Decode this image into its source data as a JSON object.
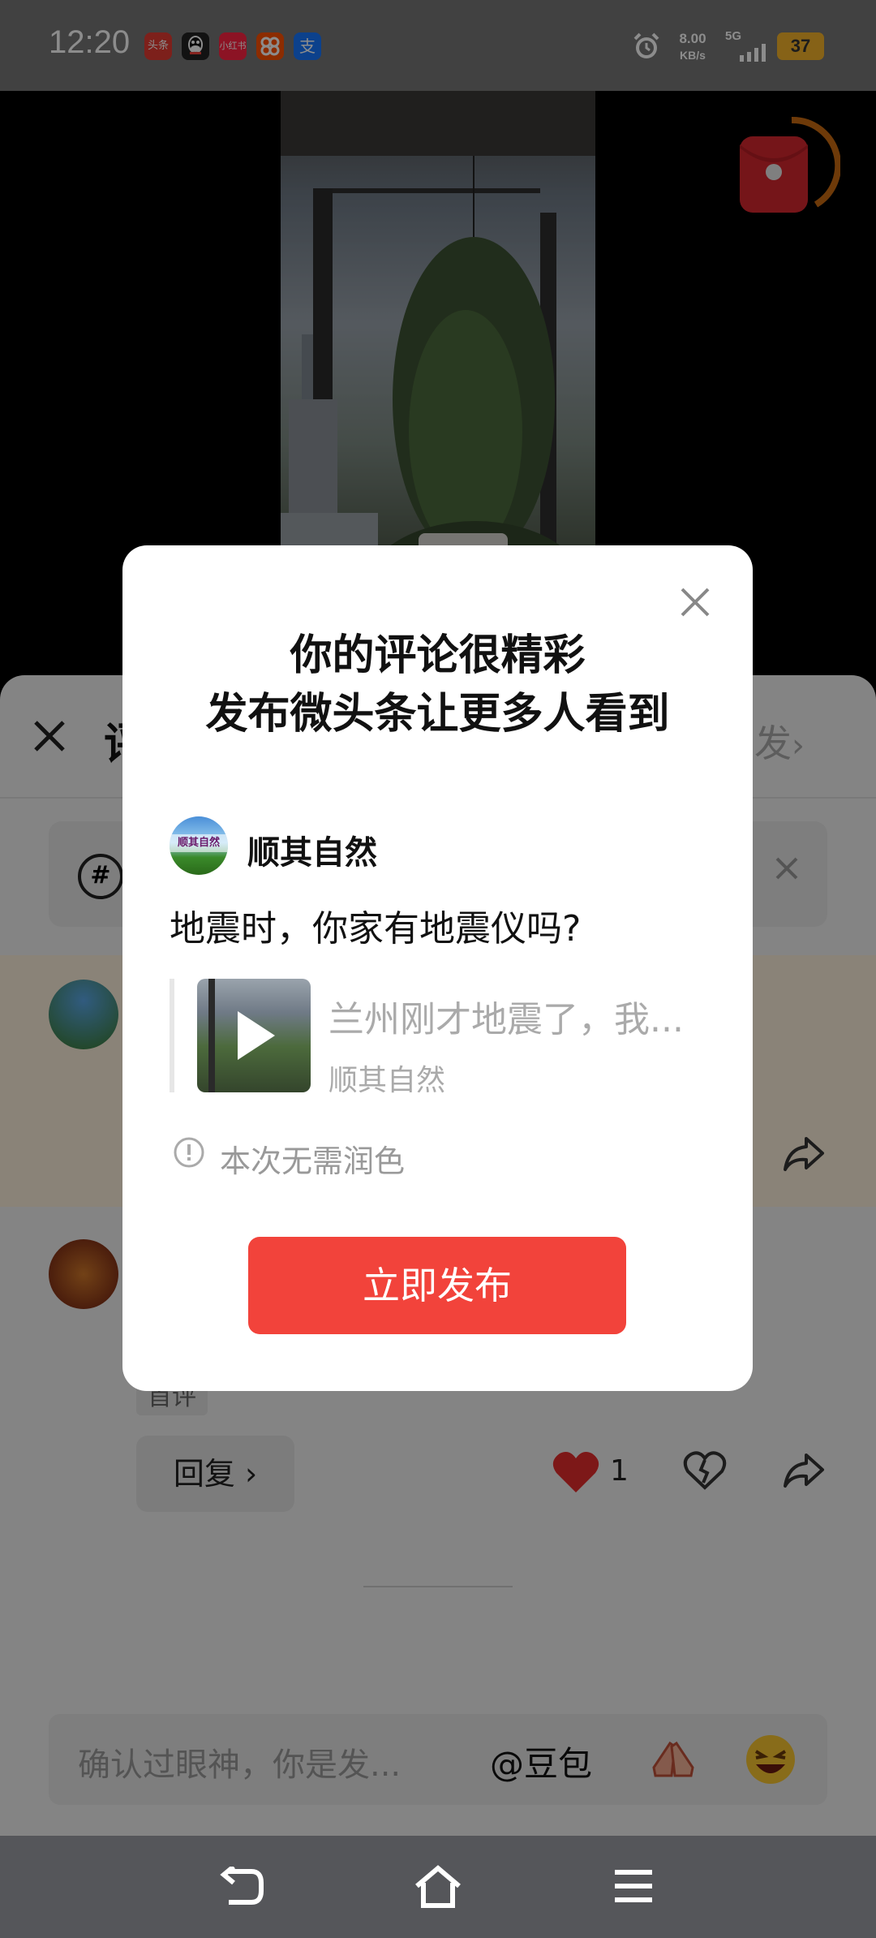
{
  "status_bar": {
    "time": "12:20",
    "apps": [
      {
        "icon": "toutiao-app-icon",
        "label": "头条",
        "color": "#e33b32"
      },
      {
        "icon": "qq-app-icon",
        "label": "",
        "color": "#222222"
      },
      {
        "icon": "xiaohongshu-app-icon",
        "label": "小红书",
        "color": "#ff2442"
      },
      {
        "icon": "taobao-app-icon",
        "label": "",
        "color": "#ff5000"
      },
      {
        "icon": "alipay-app-icon",
        "label": "支",
        "color": "#1677ff"
      }
    ],
    "net_speed_value": "8.00",
    "net_speed_unit": "KB/s",
    "signal": "5G",
    "battery": "37"
  },
  "comment_panel": {
    "header_prefix": "评",
    "header_right": "发",
    "topic_hint": "#",
    "replies": [
      {
        "tag": "首评",
        "reply_label": "回复",
        "like_count": "1"
      }
    ],
    "input_placeholder": "确认过眼神，你是发...",
    "mention": "@豆包"
  },
  "dialog": {
    "title_line1": "你的评论很精彩",
    "title_line2": "发布微头条让更多人看到",
    "author": "顺其自然",
    "avatar_text": "顺其自然",
    "comment_text": "地震时，你家有地震仪吗?",
    "quote_title": "兰州刚才地震了，我...",
    "quote_author": "顺其自然",
    "notice": "本次无需润色",
    "publish_label": "立即发布"
  },
  "colors": {
    "accent": "#f2433b",
    "battery": "#f5b32a",
    "like_red": "#e32d2d"
  }
}
